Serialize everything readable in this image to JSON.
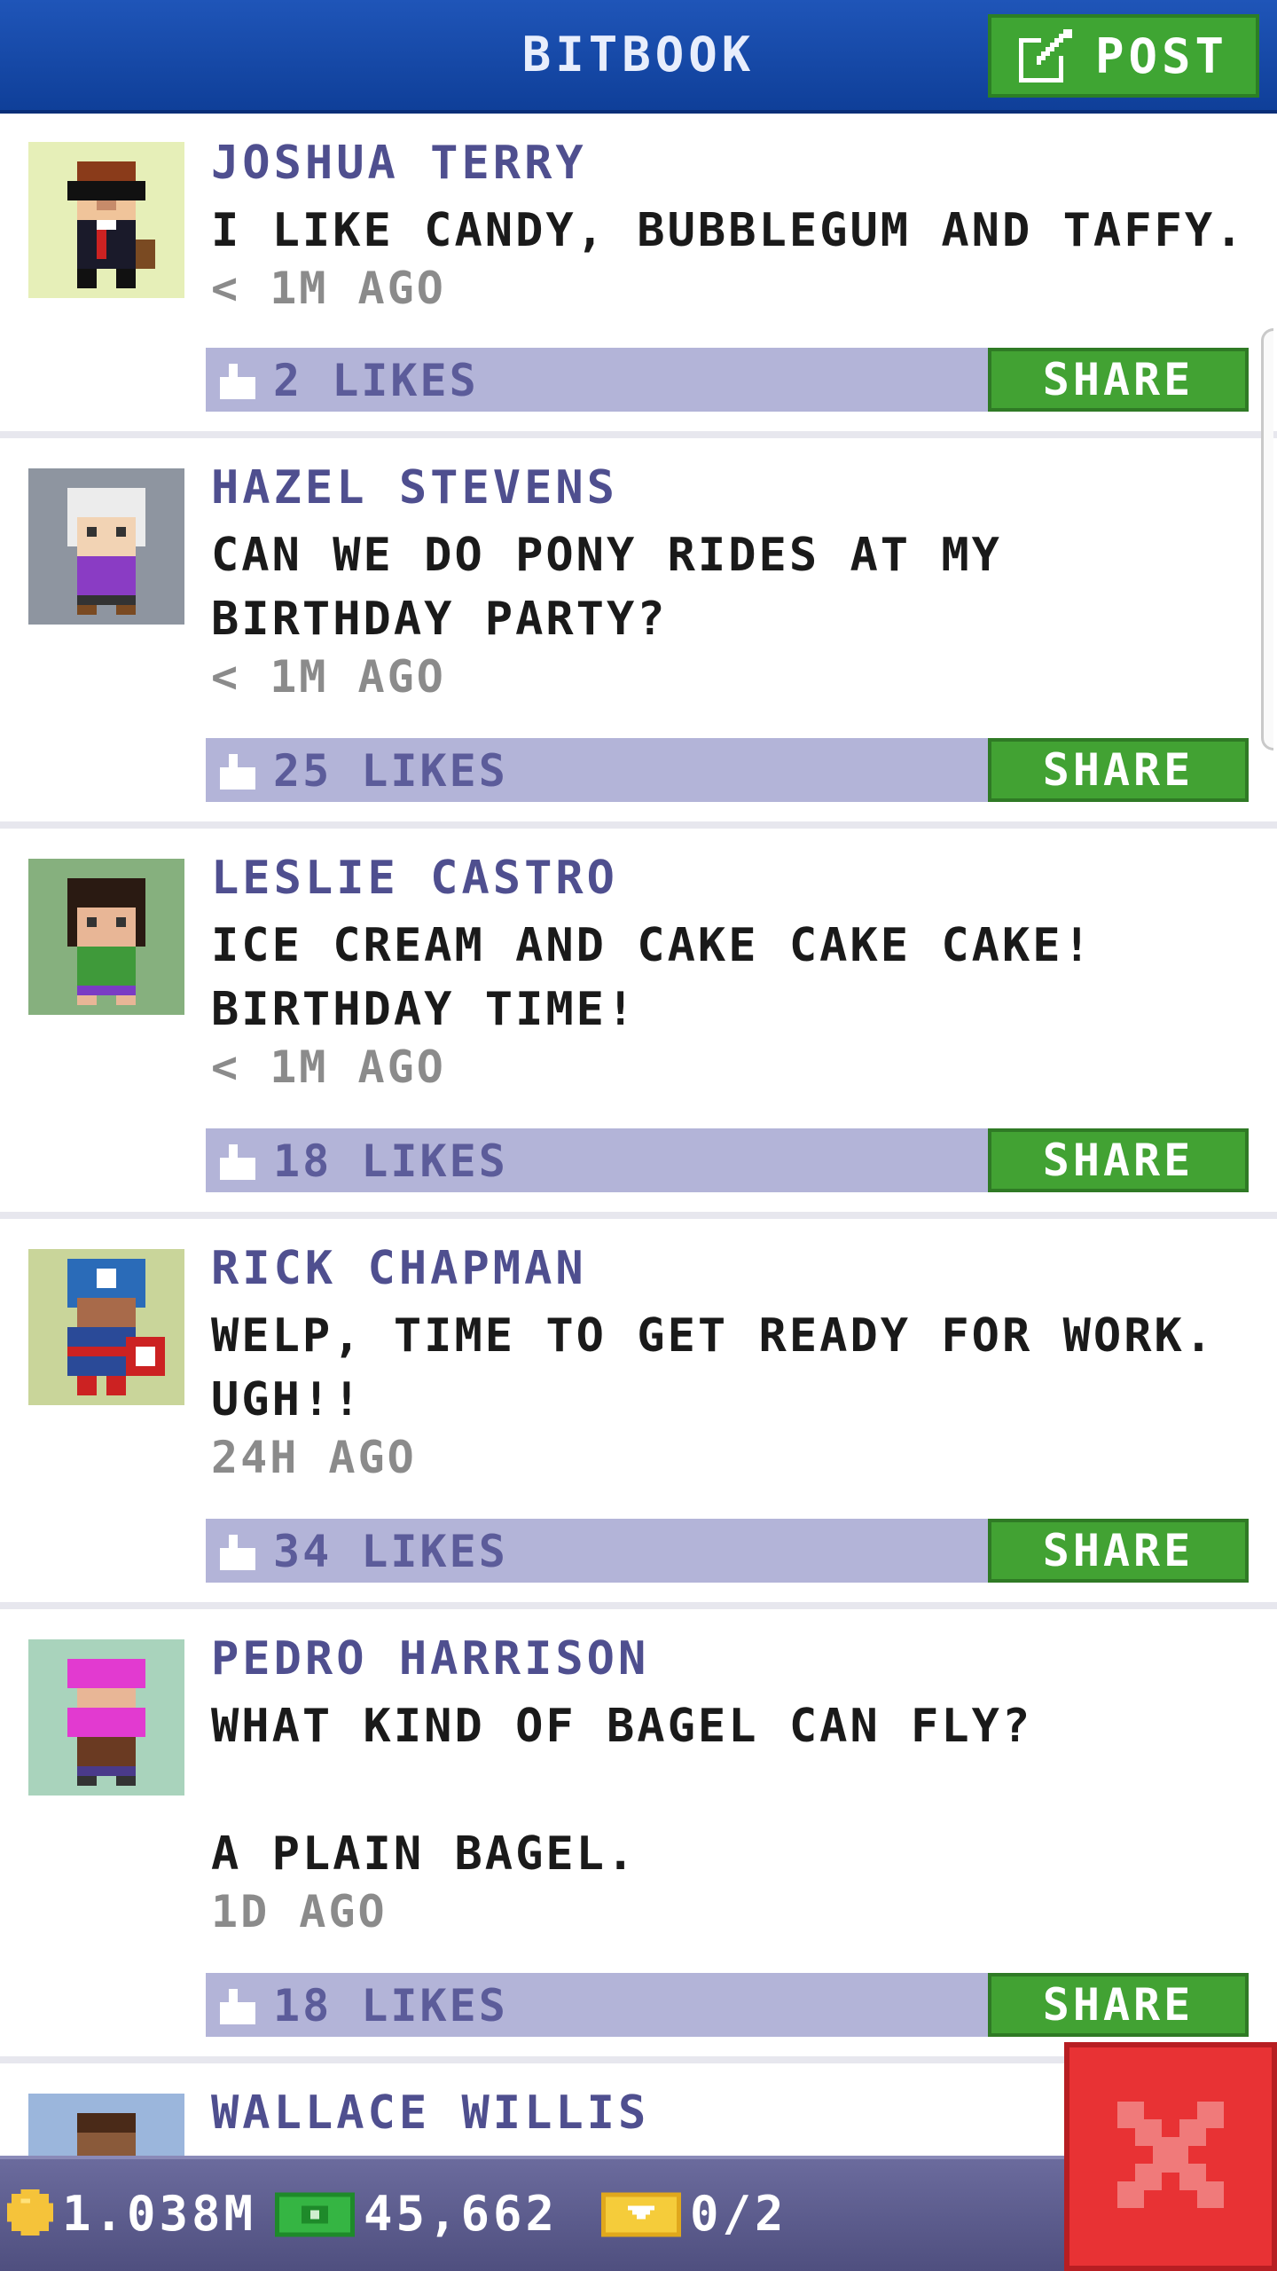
{
  "header": {
    "title": "BITBOOK",
    "post_label": "POST"
  },
  "posts": [
    {
      "name": "JOSHUA TERRY",
      "text": "I LIKE CANDY, BUBBLEGUM AND TAFFY.",
      "time": "< 1M AGO",
      "likes": "2 LIKES",
      "share_label": "SHARE",
      "avatar_bg": "#e6efb8"
    },
    {
      "name": "HAZEL STEVENS",
      "text": "CAN WE DO PONY RIDES AT MY\nBIRTHDAY PARTY?",
      "time": "< 1M AGO",
      "likes": "25 LIKES",
      "share_label": "SHARE",
      "avatar_bg": "#8e95a0"
    },
    {
      "name": "LESLIE CASTRO",
      "text": "ICE CREAM AND CAKE CAKE CAKE!\nBIRTHDAY TIME!",
      "time": "< 1M AGO",
      "likes": "18 LIKES",
      "share_label": "SHARE",
      "avatar_bg": "#86b07e"
    },
    {
      "name": "RICK CHAPMAN",
      "text": "WELP, TIME TO GET READY FOR WORK.\nUGH!!",
      "time": "24H AGO",
      "likes": "34 LIKES",
      "share_label": "SHARE",
      "avatar_bg": "#c9d59a"
    },
    {
      "name": "PEDRO HARRISON",
      "text": "WHAT KIND OF BAGEL CAN FLY?\n\nA PLAIN BAGEL.",
      "time": "1D AGO",
      "likes": "18 LIKES",
      "share_label": "SHARE",
      "avatar_bg": "#a9d3bc"
    },
    {
      "name": "WALLACE WILLIS",
      "text": "",
      "time": "",
      "likes": "",
      "share_label": "",
      "avatar_bg": "#9bb6dc"
    }
  ],
  "bottom_bar": {
    "coins": "1.038M",
    "bux": "45,662",
    "tickets": "0/2"
  },
  "colors": {
    "accent_blue": "#1f55b8",
    "share_green": "#42a233",
    "close_red": "#e83234",
    "likes_bar": "#b3b4d8",
    "name_purple": "#4f4f8f"
  }
}
